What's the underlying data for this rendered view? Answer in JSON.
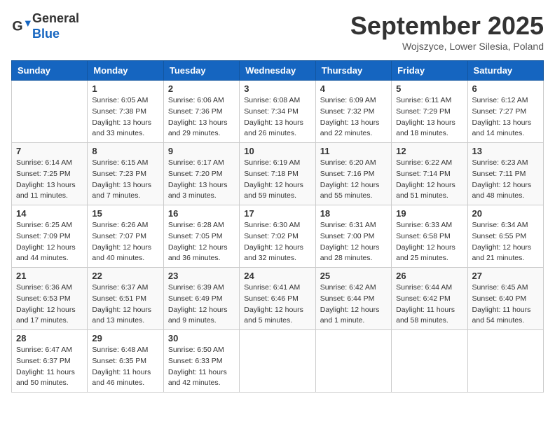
{
  "logo": {
    "general": "General",
    "blue": "Blue"
  },
  "title": "September 2025",
  "location": "Wojszyce, Lower Silesia, Poland",
  "days_of_week": [
    "Sunday",
    "Monday",
    "Tuesday",
    "Wednesday",
    "Thursday",
    "Friday",
    "Saturday"
  ],
  "weeks": [
    [
      {
        "day": "",
        "info": ""
      },
      {
        "day": "1",
        "info": "Sunrise: 6:05 AM\nSunset: 7:38 PM\nDaylight: 13 hours\nand 33 minutes."
      },
      {
        "day": "2",
        "info": "Sunrise: 6:06 AM\nSunset: 7:36 PM\nDaylight: 13 hours\nand 29 minutes."
      },
      {
        "day": "3",
        "info": "Sunrise: 6:08 AM\nSunset: 7:34 PM\nDaylight: 13 hours\nand 26 minutes."
      },
      {
        "day": "4",
        "info": "Sunrise: 6:09 AM\nSunset: 7:32 PM\nDaylight: 13 hours\nand 22 minutes."
      },
      {
        "day": "5",
        "info": "Sunrise: 6:11 AM\nSunset: 7:29 PM\nDaylight: 13 hours\nand 18 minutes."
      },
      {
        "day": "6",
        "info": "Sunrise: 6:12 AM\nSunset: 7:27 PM\nDaylight: 13 hours\nand 14 minutes."
      }
    ],
    [
      {
        "day": "7",
        "info": "Sunrise: 6:14 AM\nSunset: 7:25 PM\nDaylight: 13 hours\nand 11 minutes."
      },
      {
        "day": "8",
        "info": "Sunrise: 6:15 AM\nSunset: 7:23 PM\nDaylight: 13 hours\nand 7 minutes."
      },
      {
        "day": "9",
        "info": "Sunrise: 6:17 AM\nSunset: 7:20 PM\nDaylight: 13 hours\nand 3 minutes."
      },
      {
        "day": "10",
        "info": "Sunrise: 6:19 AM\nSunset: 7:18 PM\nDaylight: 12 hours\nand 59 minutes."
      },
      {
        "day": "11",
        "info": "Sunrise: 6:20 AM\nSunset: 7:16 PM\nDaylight: 12 hours\nand 55 minutes."
      },
      {
        "day": "12",
        "info": "Sunrise: 6:22 AM\nSunset: 7:14 PM\nDaylight: 12 hours\nand 51 minutes."
      },
      {
        "day": "13",
        "info": "Sunrise: 6:23 AM\nSunset: 7:11 PM\nDaylight: 12 hours\nand 48 minutes."
      }
    ],
    [
      {
        "day": "14",
        "info": "Sunrise: 6:25 AM\nSunset: 7:09 PM\nDaylight: 12 hours\nand 44 minutes."
      },
      {
        "day": "15",
        "info": "Sunrise: 6:26 AM\nSunset: 7:07 PM\nDaylight: 12 hours\nand 40 minutes."
      },
      {
        "day": "16",
        "info": "Sunrise: 6:28 AM\nSunset: 7:05 PM\nDaylight: 12 hours\nand 36 minutes."
      },
      {
        "day": "17",
        "info": "Sunrise: 6:30 AM\nSunset: 7:02 PM\nDaylight: 12 hours\nand 32 minutes."
      },
      {
        "day": "18",
        "info": "Sunrise: 6:31 AM\nSunset: 7:00 PM\nDaylight: 12 hours\nand 28 minutes."
      },
      {
        "day": "19",
        "info": "Sunrise: 6:33 AM\nSunset: 6:58 PM\nDaylight: 12 hours\nand 25 minutes."
      },
      {
        "day": "20",
        "info": "Sunrise: 6:34 AM\nSunset: 6:55 PM\nDaylight: 12 hours\nand 21 minutes."
      }
    ],
    [
      {
        "day": "21",
        "info": "Sunrise: 6:36 AM\nSunset: 6:53 PM\nDaylight: 12 hours\nand 17 minutes."
      },
      {
        "day": "22",
        "info": "Sunrise: 6:37 AM\nSunset: 6:51 PM\nDaylight: 12 hours\nand 13 minutes."
      },
      {
        "day": "23",
        "info": "Sunrise: 6:39 AM\nSunset: 6:49 PM\nDaylight: 12 hours\nand 9 minutes."
      },
      {
        "day": "24",
        "info": "Sunrise: 6:41 AM\nSunset: 6:46 PM\nDaylight: 12 hours\nand 5 minutes."
      },
      {
        "day": "25",
        "info": "Sunrise: 6:42 AM\nSunset: 6:44 PM\nDaylight: 12 hours\nand 1 minute."
      },
      {
        "day": "26",
        "info": "Sunrise: 6:44 AM\nSunset: 6:42 PM\nDaylight: 11 hours\nand 58 minutes."
      },
      {
        "day": "27",
        "info": "Sunrise: 6:45 AM\nSunset: 6:40 PM\nDaylight: 11 hours\nand 54 minutes."
      }
    ],
    [
      {
        "day": "28",
        "info": "Sunrise: 6:47 AM\nSunset: 6:37 PM\nDaylight: 11 hours\nand 50 minutes."
      },
      {
        "day": "29",
        "info": "Sunrise: 6:48 AM\nSunset: 6:35 PM\nDaylight: 11 hours\nand 46 minutes."
      },
      {
        "day": "30",
        "info": "Sunrise: 6:50 AM\nSunset: 6:33 PM\nDaylight: 11 hours\nand 42 minutes."
      },
      {
        "day": "",
        "info": ""
      },
      {
        "day": "",
        "info": ""
      },
      {
        "day": "",
        "info": ""
      },
      {
        "day": "",
        "info": ""
      }
    ]
  ]
}
